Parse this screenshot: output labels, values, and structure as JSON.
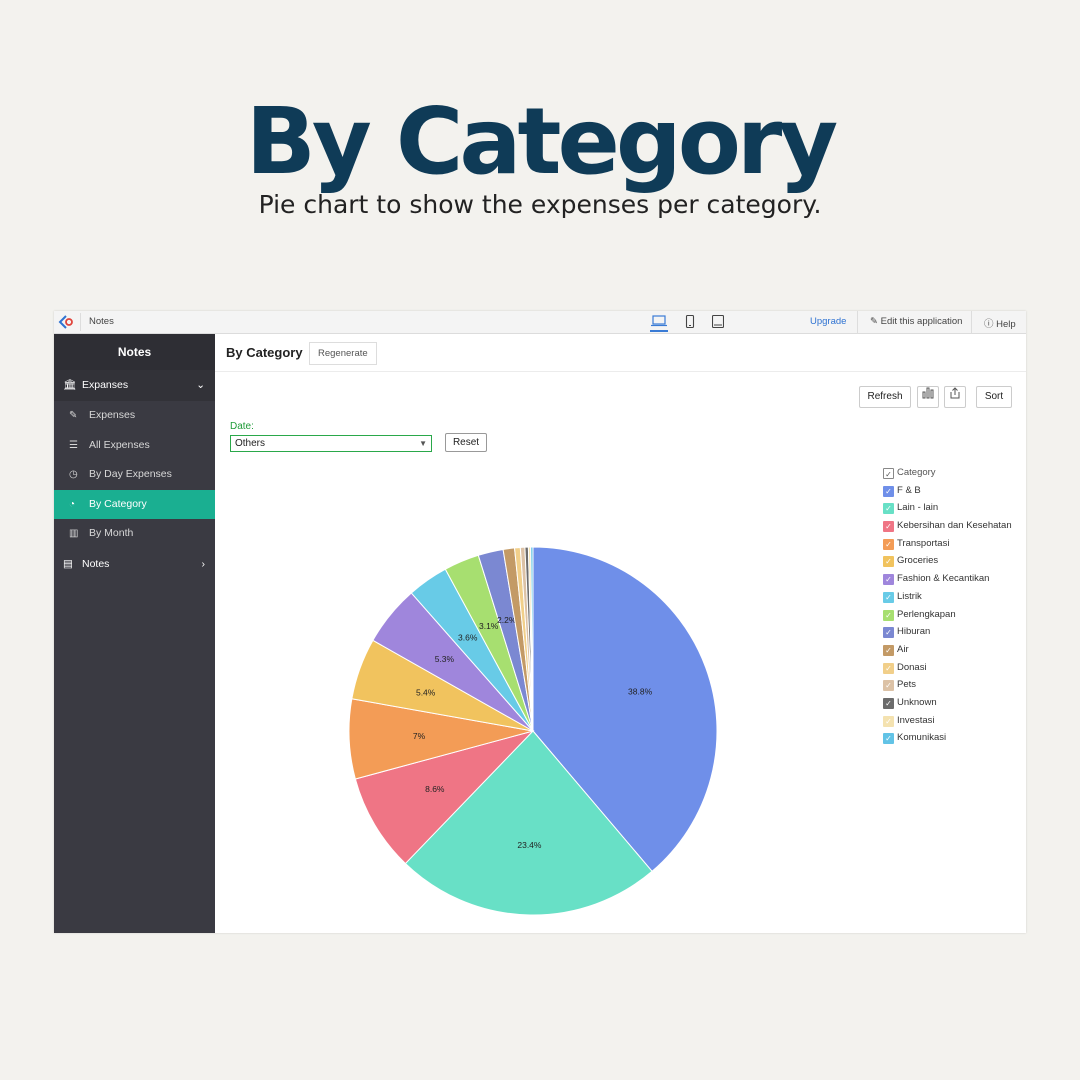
{
  "hero": {
    "title": "By Category",
    "subtitle": "Pie chart to show the expenses per category."
  },
  "topbar": {
    "app_name": "Notes",
    "upgrade": "Upgrade",
    "edit": "Edit this application",
    "help": "Help"
  },
  "sidebar": {
    "title": "Notes",
    "groups": [
      {
        "label": "Expanses",
        "icon": "bank-icon"
      },
      {
        "label": "Notes",
        "icon": "notepad-icon"
      }
    ],
    "items": [
      {
        "label": "Expenses",
        "icon": "edit-icon"
      },
      {
        "label": "All Expenses",
        "icon": "list-icon"
      },
      {
        "label": "By Day Expenses",
        "icon": "calendar-icon"
      },
      {
        "label": "By Category",
        "icon": "pie-icon"
      },
      {
        "label": "By Month",
        "icon": "bar-chart-icon"
      }
    ]
  },
  "main": {
    "title": "By Category",
    "regenerate": "Regenerate",
    "refresh": "Refresh",
    "sort": "Sort",
    "date_label": "Date:",
    "date_value": "Others",
    "reset": "Reset"
  },
  "chart_data": {
    "type": "pie",
    "legend_title": "Category",
    "legend_position": "right",
    "categories": [
      "F & B",
      "Lain - lain",
      "Kebersihan dan Kesehatan",
      "Transportasi",
      "Groceries",
      "Fashion & Kecantikan",
      "Listrik",
      "Perlengkapan",
      "Hiburan",
      "Air",
      "Donasi",
      "Pets",
      "Unknown",
      "Investasi",
      "Komunikasi"
    ],
    "values": [
      38.8,
      23.4,
      8.6,
      7,
      5.4,
      5.3,
      3.6,
      3.1,
      2.2,
      1.0,
      0.5,
      0.4,
      0.3,
      0.2,
      0.2
    ],
    "labels": [
      "38.8%",
      "23.4%",
      "8.6%",
      "7%",
      "5.4%",
      "5.3%",
      "3.6%",
      "3.1%",
      "2.2%",
      "",
      "",
      "",
      "",
      "",
      ""
    ],
    "colors": [
      "#6f8fe9",
      "#68e0c6",
      "#ef7585",
      "#f39c56",
      "#f1c35e",
      "#9f86dc",
      "#68cbe7",
      "#a7df70",
      "#7b88d2",
      "#c39a66",
      "#f1cf8a",
      "#dcc2a6",
      "#6b6b6b",
      "#f4e2b0",
      "#62c3e6"
    ]
  }
}
